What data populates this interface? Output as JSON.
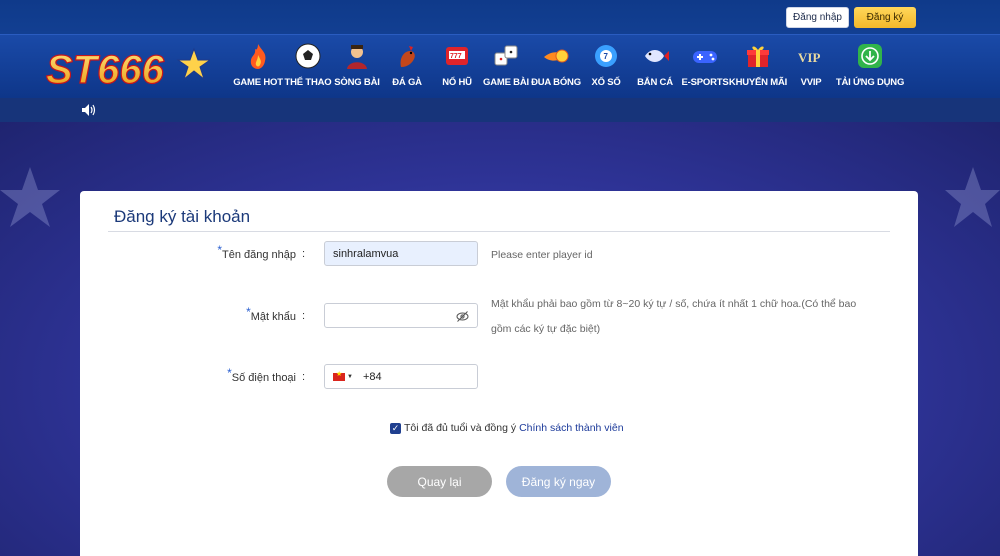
{
  "topbar": {
    "login_label": "Đăng nhập",
    "register_label": "Đăng ký"
  },
  "brand": {
    "logo_text": "ST666",
    "accent": "#f3b82a",
    "primary": "#0e3689"
  },
  "nav": [
    {
      "label": "GAME HOT",
      "icon": "flame-icon"
    },
    {
      "label": "THỂ THAO",
      "icon": "soccer-ball-icon"
    },
    {
      "label": "SÒNG BÀI",
      "icon": "dealer-icon"
    },
    {
      "label": "ĐÁ GÀ",
      "icon": "rooster-icon"
    },
    {
      "label": "NỔ HŨ",
      "icon": "slot-machine-icon"
    },
    {
      "label": "GAME BÀI",
      "icon": "dice-icon"
    },
    {
      "label": "ĐUA BÓNG",
      "icon": "fireball-icon"
    },
    {
      "label": "XỔ SỐ",
      "icon": "lottery-ball-icon"
    },
    {
      "label": "BẮN CÁ",
      "icon": "fish-icon"
    },
    {
      "label": "E-SPORTS",
      "icon": "gamepad-icon"
    },
    {
      "label": "KHUYẾN MÃI",
      "icon": "gift-icon"
    },
    {
      "label": "VVIP",
      "icon": "vip-icon"
    },
    {
      "label": "TẢI ỨNG DỤNG",
      "icon": "download-icon"
    }
  ],
  "form": {
    "title": "Đăng ký tài khoản",
    "username": {
      "label": "Tên đăng nhập",
      "value": "sinhralamvua",
      "hint": "Please enter player id"
    },
    "password": {
      "label": "Mật khẩu",
      "value": "",
      "hint_line1": "Mật khẩu phải bao gồm từ 8~20 ký tự / số, chứa ít nhất 1 chữ hoa.(Có thể bao",
      "hint_line2": "gồm các ký tự đặc biệt)"
    },
    "phone": {
      "label": "Số điện thoại",
      "country_code": "+84"
    },
    "required_mark": "*",
    "colon": ":",
    "agree_text": "Tôi đã đủ tuổi và đồng ý",
    "agree_checked": true,
    "policy_link": "Chính sách thành viên",
    "back_button": "Quay lại",
    "submit_button": "Đăng ký ngay"
  }
}
